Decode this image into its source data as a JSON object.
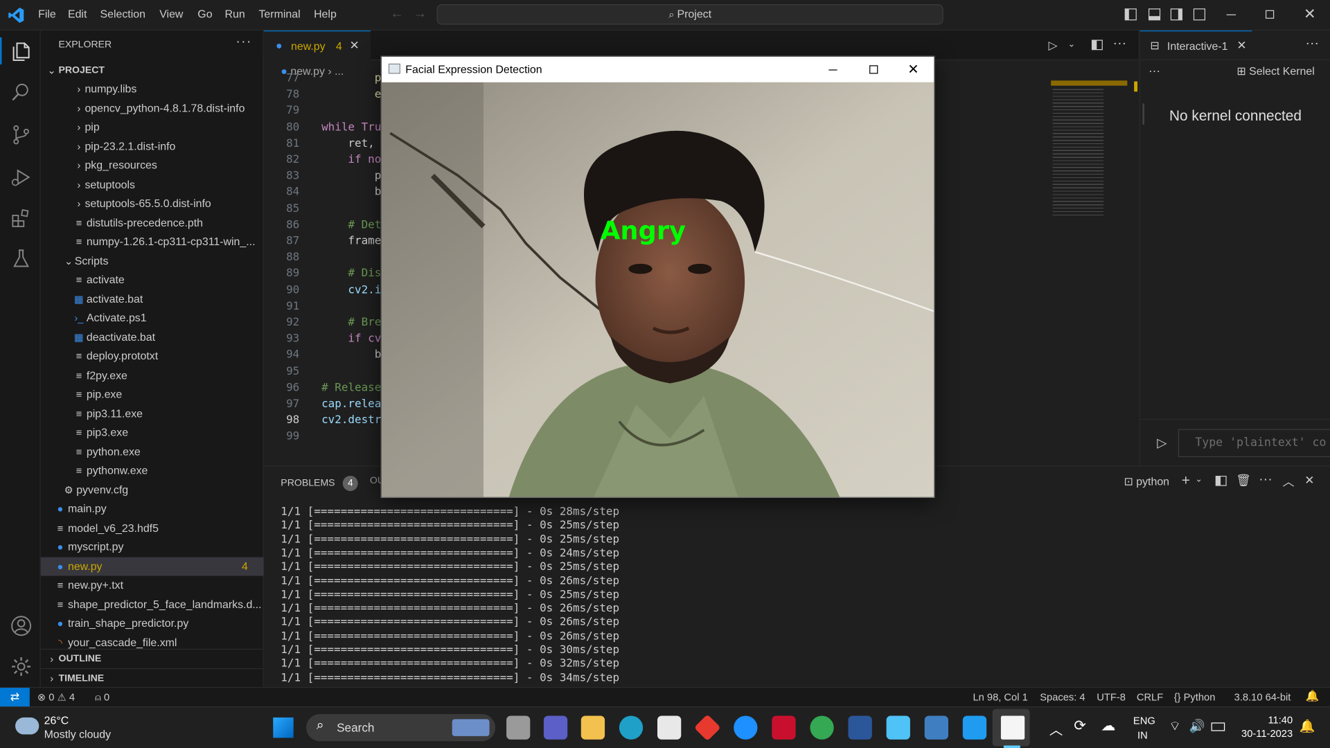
{
  "menu": [
    "File",
    "Edit",
    "Selection",
    "View",
    "Go",
    "Run",
    "Terminal",
    "Help"
  ],
  "command_center": "Project",
  "explorer": {
    "title": "EXPLORER",
    "section": "PROJECT",
    "items": [
      {
        "label": "numpy.libs",
        "kind": "folder",
        "depth": 2
      },
      {
        "label": "opencv_python-4.8.1.78.dist-info",
        "kind": "folder",
        "depth": 2
      },
      {
        "label": "pip",
        "kind": "folder",
        "depth": 2
      },
      {
        "label": "pip-23.2.1.dist-info",
        "kind": "folder",
        "depth": 2
      },
      {
        "label": "pkg_resources",
        "kind": "folder",
        "depth": 2
      },
      {
        "label": "setuptools",
        "kind": "folder",
        "depth": 2
      },
      {
        "label": "setuptools-65.5.0.dist-info",
        "kind": "folder",
        "depth": 2
      },
      {
        "label": "distutils-precedence.pth",
        "kind": "file",
        "depth": 2
      },
      {
        "label": "numpy-1.26.1-cp311-cp311-win_...",
        "kind": "file",
        "depth": 2
      },
      {
        "label": "Scripts",
        "kind": "folder-open",
        "depth": 1
      },
      {
        "label": "activate",
        "kind": "file",
        "depth": 2
      },
      {
        "label": "activate.bat",
        "kind": "bat",
        "depth": 2
      },
      {
        "label": "Activate.ps1",
        "kind": "ps",
        "depth": 2
      },
      {
        "label": "deactivate.bat",
        "kind": "bat",
        "depth": 2
      },
      {
        "label": "deploy.prototxt",
        "kind": "file",
        "depth": 2
      },
      {
        "label": "f2py.exe",
        "kind": "file",
        "depth": 2
      },
      {
        "label": "pip.exe",
        "kind": "file",
        "depth": 2
      },
      {
        "label": "pip3.11.exe",
        "kind": "file",
        "depth": 2
      },
      {
        "label": "pip3.exe",
        "kind": "file",
        "depth": 2
      },
      {
        "label": "python.exe",
        "kind": "file",
        "depth": 2
      },
      {
        "label": "pythonw.exe",
        "kind": "file",
        "depth": 2
      },
      {
        "label": "pyvenv.cfg",
        "kind": "gear",
        "depth": 1
      },
      {
        "label": "main.py",
        "kind": "py",
        "depth": 0
      },
      {
        "label": "model_v6_23.hdf5",
        "kind": "file",
        "depth": 0
      },
      {
        "label": "myscript.py",
        "kind": "py",
        "depth": 0
      },
      {
        "label": "new.py",
        "kind": "py",
        "depth": 0,
        "selected": true,
        "badge": "4"
      },
      {
        "label": "new.py+.txt",
        "kind": "file",
        "depth": 0
      },
      {
        "label": "shape_predictor_5_face_landmarks.d...",
        "kind": "file",
        "depth": 0
      },
      {
        "label": "train_shape_predictor.py",
        "kind": "py",
        "depth": 0
      },
      {
        "label": "your_cascade_file.xml",
        "kind": "rss",
        "depth": 0
      }
    ],
    "outline": "OUTLINE",
    "timeline": "TIMELINE"
  },
  "editor": {
    "tab_label": "new.py",
    "tab_badge": "4",
    "breadcrumb_file": "new.py",
    "breadcrumb_rest": "...",
    "lines": [
      {
        "n": "77",
        "code": "        print("
      },
      {
        "n": "78",
        "code": "        exit("
      },
      {
        "n": "79",
        "code": ""
      },
      {
        "n": "80",
        "code": "while Tru"
      },
      {
        "n": "81",
        "code": "    ret, "
      },
      {
        "n": "82",
        "code": "    if no"
      },
      {
        "n": "83",
        "code": "        p"
      },
      {
        "n": "84",
        "code": "        b"
      },
      {
        "n": "85",
        "code": ""
      },
      {
        "n": "86",
        "code": "    # Det"
      },
      {
        "n": "87",
        "code": "    frame"
      },
      {
        "n": "88",
        "code": ""
      },
      {
        "n": "89",
        "code": "    # Dis"
      },
      {
        "n": "90",
        "code": "    cv2.i"
      },
      {
        "n": "91",
        "code": ""
      },
      {
        "n": "92",
        "code": "    # Bre"
      },
      {
        "n": "93",
        "code": "    if cv"
      },
      {
        "n": "94",
        "code": "        b"
      },
      {
        "n": "95",
        "code": ""
      },
      {
        "n": "96",
        "code": "# Release"
      },
      {
        "n": "97",
        "code": "cap.relea"
      },
      {
        "n": "98",
        "code": "cv2.destr"
      },
      {
        "n": "99",
        "code": ""
      }
    ]
  },
  "interactive": {
    "tab_label": "Interactive-1",
    "select_kernel": "Select Kernel",
    "status": "No kernel connected",
    "input_placeholder": "Type 'plaintext' co"
  },
  "panel": {
    "problems_label": "PROBLEMS",
    "problems_count": "4",
    "output_label_partial": "OU",
    "terminal_name": "python",
    "terminal_lines": [
      "1/1 [==============================] - 0s 28ms/step",
      "1/1 [==============================] - 0s 25ms/step",
      "1/1 [==============================] - 0s 25ms/step",
      "1/1 [==============================] - 0s 24ms/step",
      "1/1 [==============================] - 0s 25ms/step",
      "1/1 [==============================] - 0s 26ms/step",
      "1/1 [==============================] - 0s 25ms/step",
      "1/1 [==============================] - 0s 26ms/step",
      "1/1 [==============================] - 0s 26ms/step",
      "1/1 [==============================] - 0s 26ms/step",
      "1/1 [==============================] - 0s 30ms/step",
      "1/1 [==============================] - 0s 32ms/step",
      "1/1 [==============================] - 0s 34ms/step"
    ]
  },
  "statusbar": {
    "errors": "0",
    "warnings": "4",
    "ports": "0",
    "position": "Ln 98, Col 1",
    "spaces": "Spaces: 4",
    "encoding": "UTF-8",
    "eol": "CRLF",
    "language": "Python",
    "interpreter": "3.8.10 64-bit"
  },
  "face_window": {
    "title": "Facial Expression Detection",
    "emotion_label": "Angry",
    "label_color": "#00ff00"
  },
  "taskbar": {
    "weather_temp": "26°C",
    "weather_desc": "Mostly cloudy",
    "search_label": "Search",
    "lang_top": "ENG",
    "lang_bottom": "IN",
    "time": "11:40",
    "date": "30-11-2023"
  },
  "colors": {
    "accent": "#0078d4",
    "warning": "#cca700",
    "python_blue": "#3b8eea"
  }
}
